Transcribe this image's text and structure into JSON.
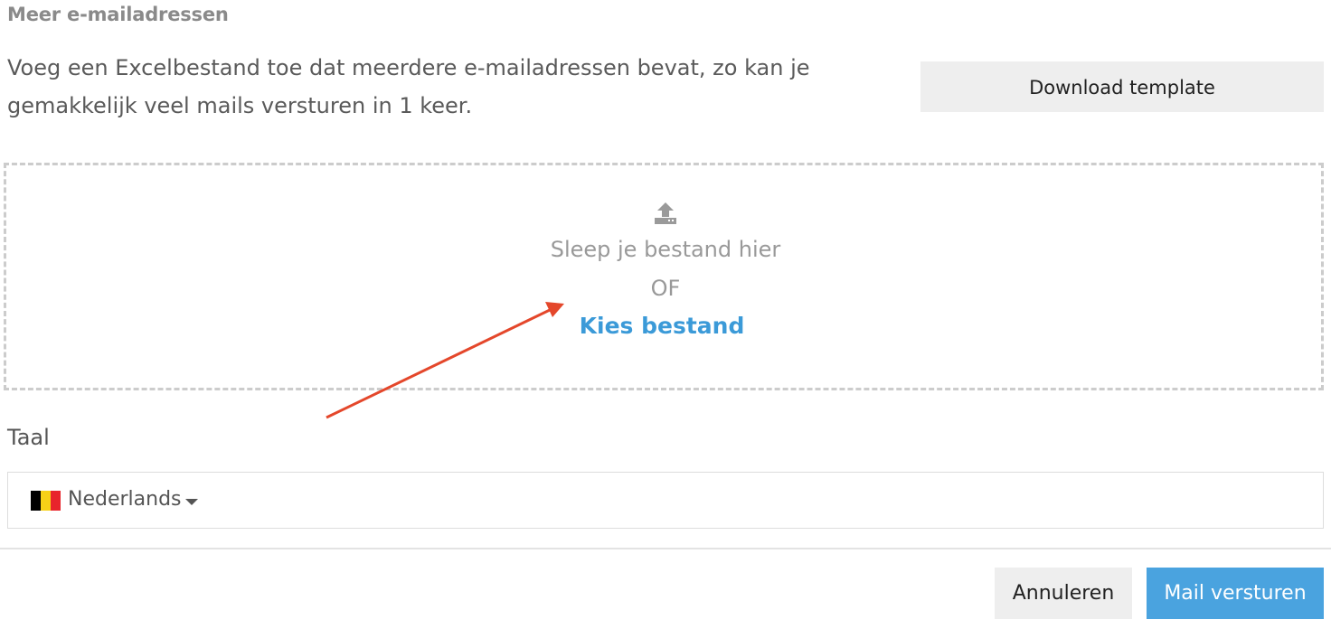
{
  "section": {
    "heading": "Meer e-mailadressen",
    "intro": "Voeg een Excelbestand toe dat meerdere e-mailadressen bevat, zo kan je gemakkelijk veel mails versturen in 1 keer.",
    "download_label": "Download template"
  },
  "dropzone": {
    "icon": "upload-icon",
    "drag_text": "Sleep je bestand hier",
    "or_text": "OF",
    "choose_label": "Kies bestand"
  },
  "language": {
    "label": "Taal",
    "selected": "Nederlands",
    "flag_colors": [
      "#000000",
      "#f7d117",
      "#e8242c"
    ]
  },
  "footer": {
    "cancel_label": "Annuleren",
    "send_label": "Mail versturen"
  },
  "colors": {
    "accent": "#4aa3df",
    "link": "#3b9ad8",
    "annotation_arrow": "#e4472b"
  }
}
